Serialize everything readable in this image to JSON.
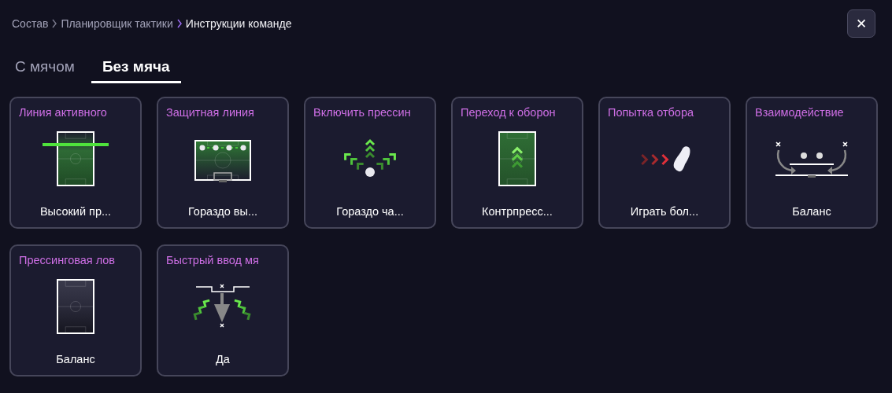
{
  "breadcrumb": [
    {
      "label": "Состав",
      "current": false
    },
    {
      "label": "Планировщик тактики",
      "current": false
    },
    {
      "label": "Инструкции команде",
      "current": true
    }
  ],
  "close": {
    "label": "✕"
  },
  "tabs": [
    {
      "label": "С мячом",
      "selected": false
    },
    {
      "label": "Без мяча",
      "selected": true
    }
  ],
  "cards": [
    {
      "title": "Линия активного",
      "value": "Высокий пр...",
      "kind": "pitch-line"
    },
    {
      "title": "Защитная линия",
      "value": "Гораздо вы...",
      "kind": "defensive-line"
    },
    {
      "title": "Включить прессин",
      "value": "Гораздо ча...",
      "kind": "press-arrows"
    },
    {
      "title": "Переход к оборон",
      "value": "Контрпресс...",
      "kind": "pitch-arrows"
    },
    {
      "title": "Попытка отбора",
      "value": "Играть бол...",
      "kind": "tackle"
    },
    {
      "title": "Взаимодействие",
      "value": "Баланс",
      "kind": "interaction"
    },
    {
      "title": "Прессинговая лов",
      "value": "Баланс",
      "kind": "pitch-dark"
    },
    {
      "title": "Быстрый ввод мя",
      "value": "Да",
      "kind": "throw-in"
    }
  ]
}
